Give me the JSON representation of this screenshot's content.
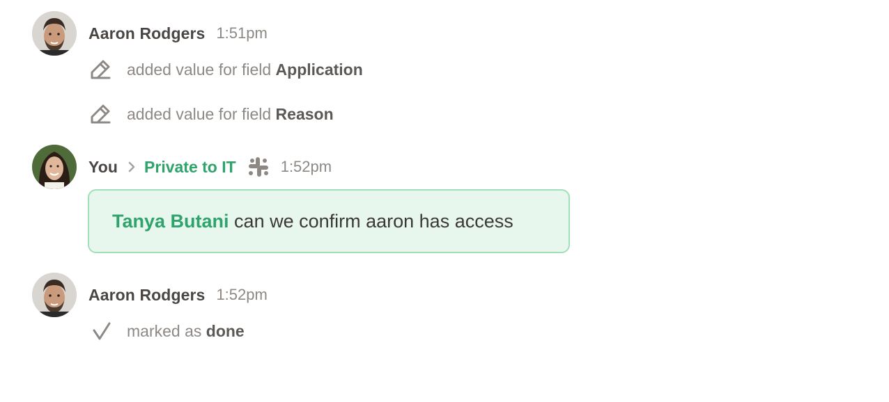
{
  "entries": [
    {
      "author": "Aaron Rodgers",
      "time": "1:51pm",
      "avatar_icon": "man-avatar",
      "activities": [
        {
          "icon": "pencil-edit-icon",
          "text": "added value for field",
          "field": "Application"
        },
        {
          "icon": "pencil-edit-icon",
          "text": "added value for field",
          "field": "Reason"
        }
      ]
    },
    {
      "author": "You",
      "time": "1:52pm",
      "avatar_icon": "woman-avatar",
      "channel": "Private to IT",
      "source_icon": "slack-icon",
      "message": {
        "mention": "Tanya Butani",
        "text": "can we confirm aaron has access"
      }
    },
    {
      "author": "Aaron Rodgers",
      "time": "1:52pm",
      "avatar_icon": "man-avatar",
      "activities": [
        {
          "icon": "checkmark-icon",
          "text": "marked as",
          "field": "done"
        }
      ]
    }
  ],
  "colors": {
    "accent_green": "#2ea36b",
    "bubble_bg": "#e8f7ee",
    "bubble_border": "#9fe0b8",
    "muted_text": "#8d8884"
  }
}
